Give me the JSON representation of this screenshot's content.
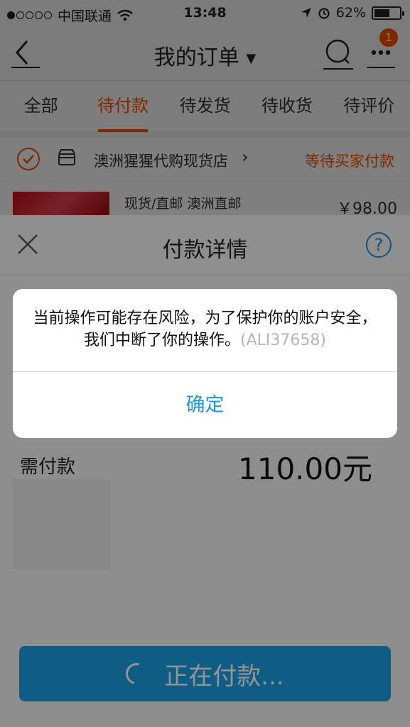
{
  "status_bar": {
    "carrier": "中国联通",
    "time": "13:48",
    "battery": "62%",
    "battery_level": 0.62
  },
  "nav": {
    "title": "我的订单",
    "more_badge": "1"
  },
  "tabs": [
    {
      "label": "全部",
      "active": false
    },
    {
      "label": "待付款",
      "active": true
    },
    {
      "label": "待发货",
      "active": false
    },
    {
      "label": "待收货",
      "active": false
    },
    {
      "label": "待评价",
      "active": false
    }
  ],
  "order": {
    "shop_name": "澳洲猩猩代购现货店",
    "status": "等待买家付款",
    "item_title": "现货/直邮 澳洲直邮",
    "price": "￥98.00"
  },
  "payment_sheet": {
    "title": "付款详情",
    "help": "?",
    "amount_label": "需付款",
    "amount_value": "110.00元",
    "pay_button": "正在付款..."
  },
  "alert": {
    "message": "当前操作可能存在风险，为了保护你的账户安全，我们中断了你的操作。",
    "code": "(ALI37658)",
    "confirm": "确定"
  },
  "colors": {
    "accent": "#ff5000",
    "link": "#1a9be0",
    "pay_button": "#1aa1e6"
  }
}
